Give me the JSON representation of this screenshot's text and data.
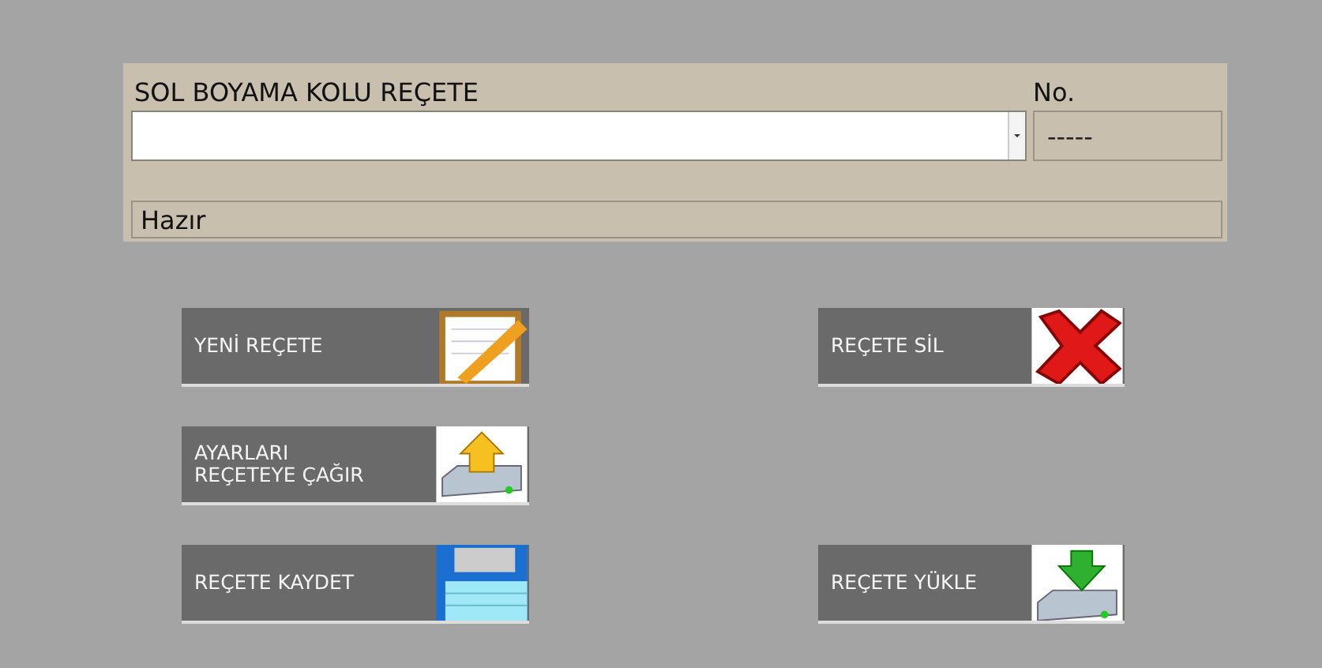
{
  "recipe_panel": {
    "title": "SOL BOYAMA KOLU REÇETE",
    "number_label": "No.",
    "number_value": "-----",
    "status": "Hazır"
  },
  "button_rows": [
    {
      "left": {
        "label": "YENİ REÇETE",
        "kind": "new"
      },
      "right": {
        "label": "REÇETE SİL",
        "kind": "delete"
      }
    },
    {
      "left": {
        "label": "AYARLARI\nREÇETEYE ÇAĞIR",
        "kind": "fetch"
      }
    },
    {
      "left": {
        "label": "REÇETE KAYDET",
        "kind": "save"
      },
      "right": {
        "label": "REÇETE YÜKLE",
        "kind": "load"
      }
    }
  ]
}
